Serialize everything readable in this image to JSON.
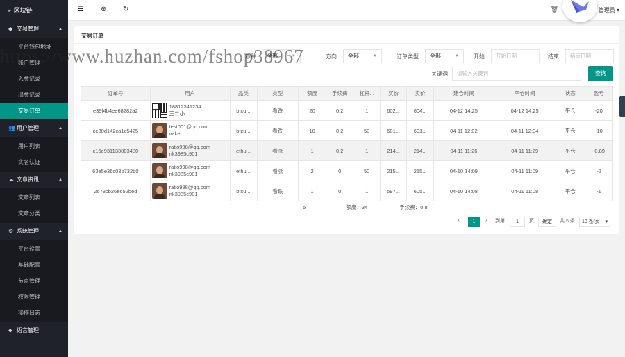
{
  "sidebar": {
    "logo": "区块链",
    "groups": [
      {
        "title": "交易管理",
        "items": [
          "平台钱包地址",
          "账户管理",
          "入金记录",
          "出金记录",
          "交易订单"
        ]
      },
      {
        "title": "用户管理",
        "items": [
          "用户列表",
          "实名认证"
        ]
      },
      {
        "title": "文章资讯",
        "items": [
          "文章列表",
          "文章分类"
        ]
      },
      {
        "title": "系统管理",
        "items": [
          "平台设置",
          "基础配置",
          "节点管理",
          "权限管理",
          "操作日志"
        ]
      },
      {
        "title": "语言管理"
      }
    ],
    "active_item": "交易订单"
  },
  "topbar": {
    "user": "管理员"
  },
  "card": {
    "title": "交易订单"
  },
  "filters": {
    "type_label": "币种",
    "type_value": "全部",
    "dir_label": "方向",
    "dir_value": "全部",
    "order_type_label": "订单类型",
    "order_type_value": "全部",
    "start_label": "开始",
    "start_placeholder": "开始日期",
    "end_label": "结束",
    "end_placeholder": "结束日期",
    "keyword_label": "关键词",
    "keyword_placeholder": "请输入关键词",
    "query_label": "查询"
  },
  "table": {
    "headers": [
      "订单号",
      "用户",
      "品类",
      "类型",
      "额度",
      "手续费",
      "杠杆...",
      "买价",
      "卖价",
      "建仓时间",
      "平仓时间",
      "状态",
      "盈亏"
    ],
    "rows": [
      {
        "order": "e39f4b4ee68282a2",
        "user1": "18812341234",
        "user2": "王二小",
        "avatar": "qr",
        "cat": "btcu...",
        "type": "看跌",
        "amount": "20",
        "fee": "0.2",
        "lev": "1",
        "buy": "602...",
        "sell": "604...",
        "open": "04-12 14:25",
        "close": "04-12 14:25",
        "status": "平仓",
        "pnl": "-20"
      },
      {
        "order": "ce30d142ca1c5425",
        "user1": "test001@qq.com",
        "user2": "vake",
        "avatar": "photo",
        "cat": "btcu...",
        "type": "看跌",
        "amount": "10",
        "fee": "0.2",
        "lev": "50",
        "buy": "601...",
        "sell": "601...",
        "open": "04-11 12:02",
        "close": "04-11 12:04",
        "status": "平仓",
        "pnl": "-10"
      },
      {
        "order": "c16e931133803480",
        "user1": "ratio998@qq.com",
        "user2": "nk3985c901",
        "avatar": "photo",
        "cat": "ethu...",
        "type": "看涨",
        "amount": "1",
        "fee": "0.2",
        "lev": "1",
        "buy": "214...",
        "sell": "214...",
        "open": "04-11 11:26",
        "close": "04-11 11:29",
        "status": "平仓",
        "pnl": "-0.89"
      },
      {
        "order": "63e5e36c03b732b0",
        "user1": "ratio998@qq.com",
        "user2": "nk3985c901",
        "avatar": "photo",
        "cat": "ethu...",
        "type": "看涨",
        "amount": "2",
        "fee": "0",
        "lev": "50",
        "buy": "215...",
        "sell": "215...",
        "open": "04-10 14:09",
        "close": "04-11 11:09",
        "status": "平仓",
        "pnl": "-2"
      },
      {
        "order": "2678cb26e652bed",
        "user1": "ratio998@qq.com",
        "user2": "nk3985c901",
        "avatar": "photo",
        "cat": "btcu...",
        "type": "看跌",
        "amount": "1",
        "fee": "0",
        "lev": "1",
        "buy": "597...",
        "sell": "605...",
        "open": "04-10 14:08",
        "close": "04-11 11:08",
        "status": "平仓",
        "pnl": "-1"
      }
    ],
    "summary": {
      "records": "记录：5",
      "amount": "额度：34",
      "fee": "手续费：0.8"
    }
  },
  "pager": {
    "current": "1",
    "goto_label": "到第",
    "goto_value": "1",
    "page_unit": "页",
    "confirm": "确定",
    "total": "共 5 条",
    "per_page": "10 条/页"
  },
  "watermark": "https://www.huzhan.com/fshop38967"
}
